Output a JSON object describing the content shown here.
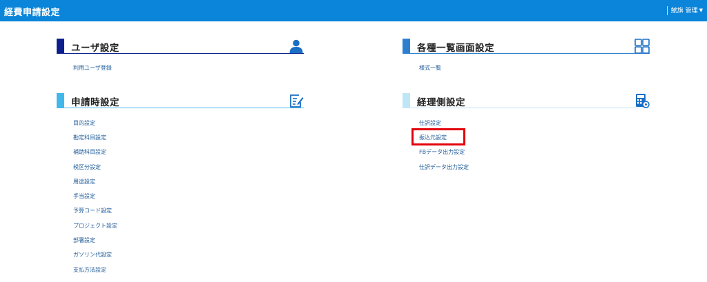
{
  "header": {
    "title": "経費申請設定",
    "user_label": "鯱旗 管理",
    "bg_color": "#0a85d9"
  },
  "sections": {
    "user": {
      "title": "ユーザ設定",
      "icon": "user-icon",
      "accent": "#0c1f8c",
      "links": [
        "利用ユーザ登録"
      ]
    },
    "list": {
      "title": "各種一覧画面設定",
      "icon": "grid-icon",
      "accent": "#2f7fd1",
      "links": [
        "様式一覧"
      ]
    },
    "apply": {
      "title": "申請時設定",
      "icon": "edit-document-icon",
      "accent": "#42b7ea",
      "links": [
        "目的設定",
        "勘定科目設定",
        "補助科目設定",
        "税区分設定",
        "用途設定",
        "手当設定",
        "予算コード設定",
        "プロジェクト設定",
        "部署設定",
        "ガソリン代設定",
        "支払方法設定"
      ]
    },
    "accounting": {
      "title": "経理側設定",
      "icon": "calculator-icon",
      "accent": "#bfe6f6",
      "links": [
        "仕訳設定",
        "振込元設定",
        "FBデータ出力設定",
        "仕訳データ出力設定"
      ]
    }
  },
  "highlight_color": "#e3000b"
}
